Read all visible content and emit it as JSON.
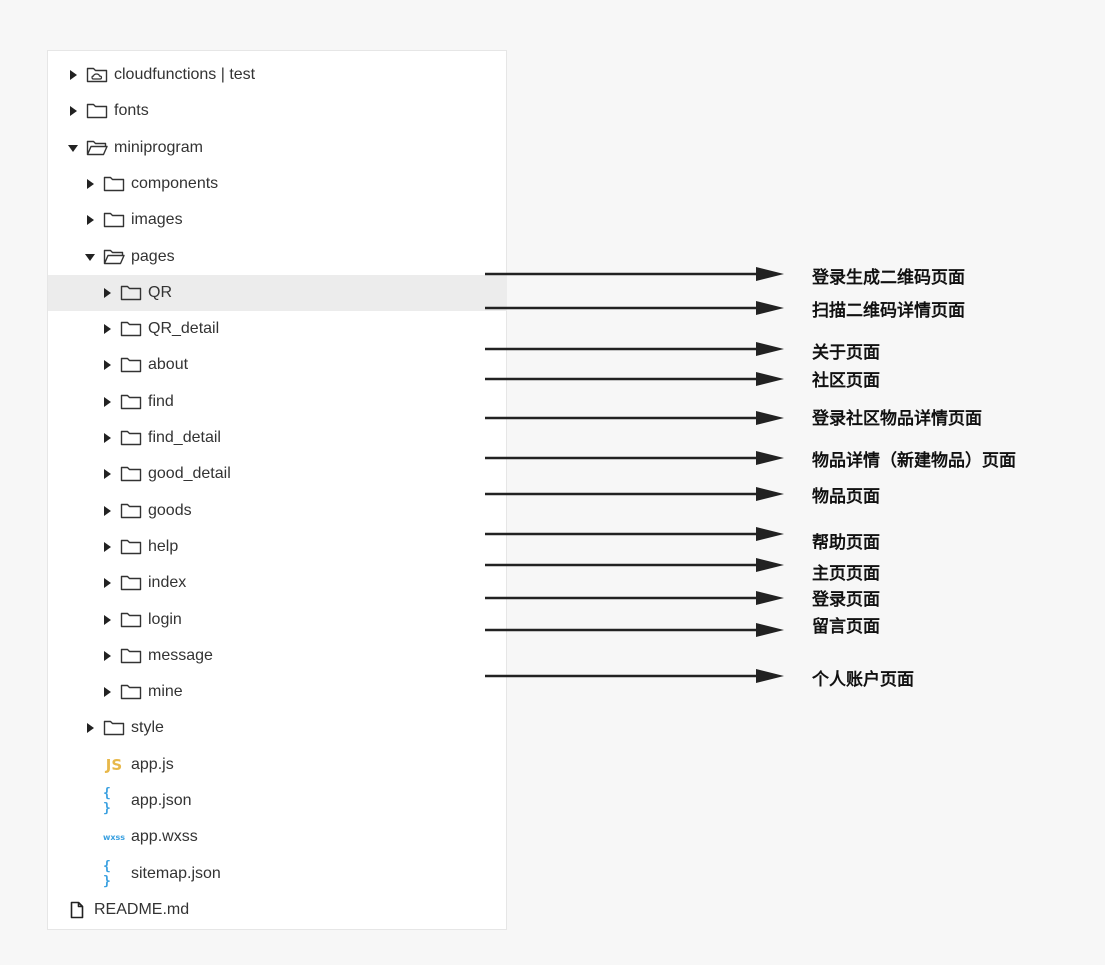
{
  "tree": [
    {
      "key": "cloudfunctions",
      "label": "cloudfunctions | test",
      "depth": 0,
      "kind": "cloud-folder",
      "expanded": false
    },
    {
      "key": "fonts",
      "label": "fonts",
      "depth": 0,
      "kind": "folder",
      "expanded": false
    },
    {
      "key": "miniprogram",
      "label": "miniprogram",
      "depth": 0,
      "kind": "folder",
      "expanded": true
    },
    {
      "key": "components",
      "label": "components",
      "depth": 1,
      "kind": "folder",
      "expanded": false
    },
    {
      "key": "images",
      "label": "images",
      "depth": 1,
      "kind": "folder",
      "expanded": false
    },
    {
      "key": "pages",
      "label": "pages",
      "depth": 1,
      "kind": "folder",
      "expanded": true
    },
    {
      "key": "qr",
      "label": "QR",
      "depth": 2,
      "kind": "folder",
      "expanded": false,
      "selected": true
    },
    {
      "key": "qr-detail",
      "label": "QR_detail",
      "depth": 2,
      "kind": "folder",
      "expanded": false
    },
    {
      "key": "about",
      "label": "about",
      "depth": 2,
      "kind": "folder",
      "expanded": false
    },
    {
      "key": "find",
      "label": "find",
      "depth": 2,
      "kind": "folder",
      "expanded": false
    },
    {
      "key": "find-detail",
      "label": "find_detail",
      "depth": 2,
      "kind": "folder",
      "expanded": false
    },
    {
      "key": "good-detail",
      "label": "good_detail",
      "depth": 2,
      "kind": "folder",
      "expanded": false
    },
    {
      "key": "goods",
      "label": "goods",
      "depth": 2,
      "kind": "folder",
      "expanded": false
    },
    {
      "key": "help",
      "label": "help",
      "depth": 2,
      "kind": "folder",
      "expanded": false
    },
    {
      "key": "index",
      "label": "index",
      "depth": 2,
      "kind": "folder",
      "expanded": false
    },
    {
      "key": "login",
      "label": "login",
      "depth": 2,
      "kind": "folder",
      "expanded": false
    },
    {
      "key": "message",
      "label": "message",
      "depth": 2,
      "kind": "folder",
      "expanded": false
    },
    {
      "key": "mine",
      "label": "mine",
      "depth": 2,
      "kind": "folder",
      "expanded": false
    },
    {
      "key": "style",
      "label": "style",
      "depth": 1,
      "kind": "folder",
      "expanded": false
    },
    {
      "key": "app-js",
      "label": "app.js",
      "depth": 1,
      "kind": "js-file",
      "icon_text": "JS"
    },
    {
      "key": "app-json",
      "label": "app.json",
      "depth": 1,
      "kind": "json-file",
      "icon_text": "{ }"
    },
    {
      "key": "app-wxss",
      "label": "app.wxss",
      "depth": 1,
      "kind": "wxss-file",
      "icon_text": "wxss"
    },
    {
      "key": "sitemap-json",
      "label": "sitemap.json",
      "depth": 1,
      "kind": "json-file",
      "icon_text": "{ }"
    },
    {
      "key": "readme",
      "label": "README.md",
      "depth": 0,
      "kind": "file"
    }
  ],
  "annotations": [
    {
      "target": "qr",
      "text": "登录生成二维码页面"
    },
    {
      "target": "qr-detail",
      "text": "扫描二维码详情页面"
    },
    {
      "target": "about",
      "text": "关于页面"
    },
    {
      "target": "find",
      "text": "社区页面"
    },
    {
      "target": "find-detail",
      "text": "登录社区物品详情页面"
    },
    {
      "target": "good-detail",
      "text": "物品详情（新建物品）页面"
    },
    {
      "target": "goods",
      "text": "物品页面"
    },
    {
      "target": "help",
      "text": "帮助页面"
    },
    {
      "target": "index",
      "text": "主页页面"
    },
    {
      "target": "login",
      "text": "登录页面"
    },
    {
      "target": "message",
      "text": "留言页面"
    },
    {
      "target": "mine",
      "text": "个人账户页面"
    }
  ],
  "colors": {
    "panel_bg": "#ffffff",
    "selected_bg": "#ececec",
    "text": "#333333",
    "arrow": "#222222",
    "js_icon": "#e8b84a",
    "json_icon": "#3aa0e0"
  }
}
